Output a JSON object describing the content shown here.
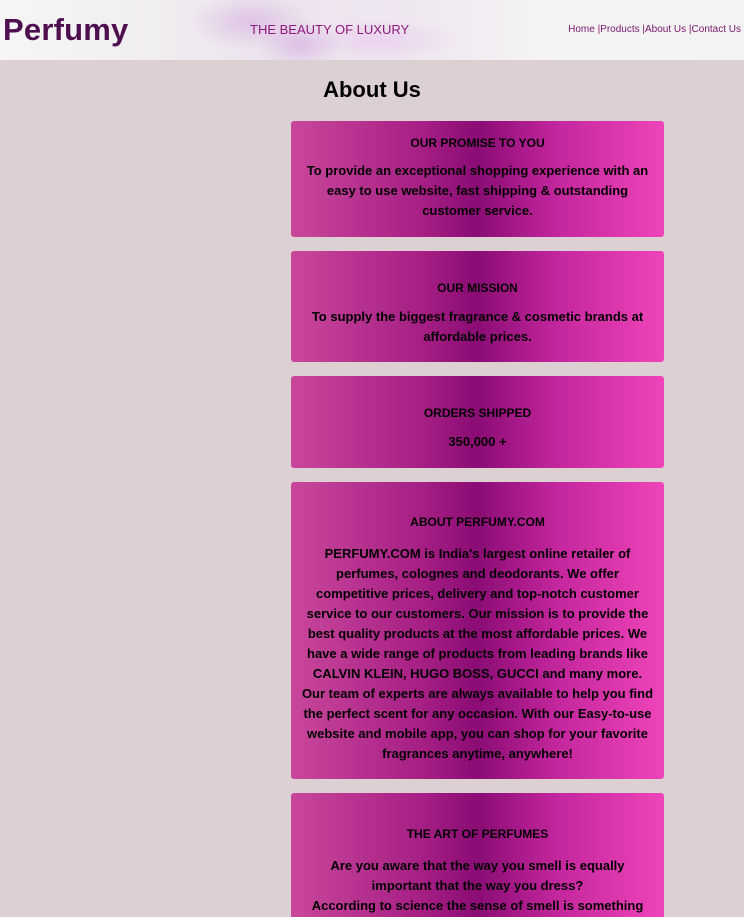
{
  "header": {
    "logo": "Perfumy",
    "tagline": "THE BEAUTY OF LUXURY",
    "nav": [
      "Home |",
      "Products |",
      "About Us |",
      "Contact Us"
    ]
  },
  "page_title": "About Us",
  "cards": [
    {
      "title": "OUR PROMISE TO YOU",
      "body": "To provide an exceptional shopping experience with an easy to use website, fast shipping & outstanding customer service."
    },
    {
      "title": "OUR MISSION",
      "body": "To supply the biggest fragrance & cosmetic brands at affordable prices."
    },
    {
      "title": "ORDERS SHIPPED",
      "body": "350,000 +"
    },
    {
      "title": "ABOUT PERFUMY.COM",
      "body": "PERFUMY.COM is India's largest online retailer of perfumes, colognes and deodorants. We offer competitive prices, delivery and top-notch customer service to our customers. Our mission is to provide the best quality products at the most affordable prices. We have a wide range of products from leading brands like CALVIN KLEIN, HUGO BOSS, GUCCI and many more. Our team of experts are always available to help you find the perfect scent for any occasion. With our Easy-to-use website and mobile app, you can shop for your favorite fragrances anytime, anywhere!"
    },
    {
      "title": "THE ART OF PERFUMES",
      "body": "Are you aware that the way you smell is equally important that the way you dress?",
      "body2": "According to science the sense of smell is something that"
    }
  ],
  "colors": {
    "background": "#ddd0d3",
    "logo": "#4e0f4e",
    "accent": "#8e1a7b",
    "card_dark": "#8a0c74",
    "card_light": "#ef44b9"
  }
}
